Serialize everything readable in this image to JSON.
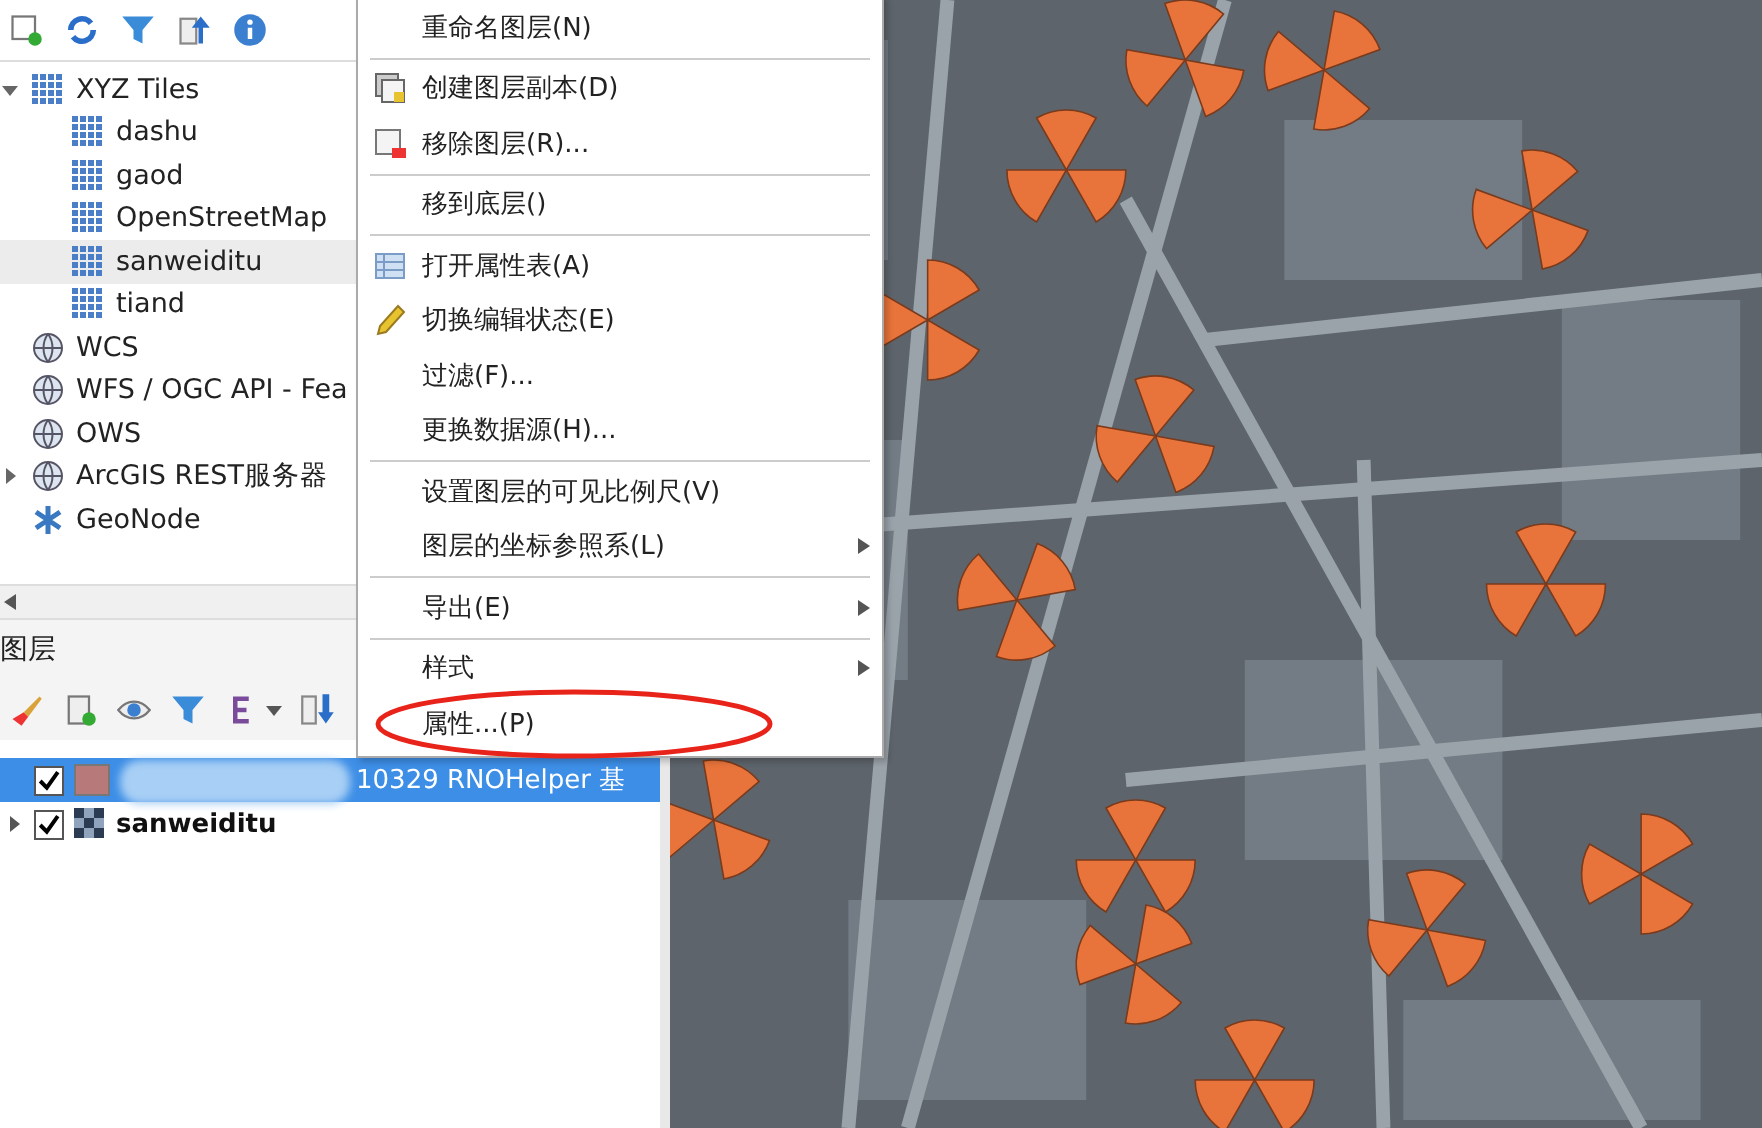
{
  "browser": {
    "tree": [
      {
        "label": "XYZ Tiles",
        "kind": "tiles",
        "expanded": true,
        "selected": false,
        "children": [
          {
            "label": "dashu",
            "kind": "tiles",
            "selected": false
          },
          {
            "label": "gaod",
            "kind": "tiles",
            "selected": false
          },
          {
            "label": "OpenStreetMap",
            "kind": "tiles",
            "selected": false
          },
          {
            "label": "sanweiditu",
            "kind": "tiles",
            "selected": true
          },
          {
            "label": "tiand",
            "kind": "tiles",
            "selected": false
          }
        ]
      },
      {
        "label": "WCS",
        "kind": "service",
        "selected": false
      },
      {
        "label": "WFS / OGC API - Fea",
        "kind": "service",
        "selected": false
      },
      {
        "label": "OWS",
        "kind": "service",
        "selected": false
      },
      {
        "label": "ArcGIS REST服务器",
        "kind": "service",
        "expanded": false,
        "selected": false
      },
      {
        "label": "GeoNode",
        "kind": "geonode",
        "selected": false
      }
    ]
  },
  "layers": {
    "title": "图层",
    "items": [
      {
        "name": "10329 RNOHelper 基",
        "kind": "vector",
        "checked": true,
        "selected": true,
        "redacted": true
      },
      {
        "name": "sanweiditu",
        "kind": "raster",
        "checked": true,
        "selected": false,
        "expanded": false
      }
    ]
  },
  "context_menu": {
    "items": [
      {
        "kind": "item",
        "label": "重命名图层(N)",
        "submenu": false,
        "circled": false
      },
      {
        "kind": "separator"
      },
      {
        "kind": "item",
        "label": "创建图层副本(D)",
        "submenu": false,
        "circled": false
      },
      {
        "kind": "item",
        "label": "移除图层(R)...",
        "submenu": false,
        "circled": false
      },
      {
        "kind": "separator"
      },
      {
        "kind": "item",
        "label": "移到底层()",
        "submenu": false,
        "circled": false
      },
      {
        "kind": "separator"
      },
      {
        "kind": "item",
        "label": "打开属性表(A)",
        "submenu": false,
        "circled": false
      },
      {
        "kind": "item",
        "label": "切换编辑状态(E)",
        "submenu": false,
        "circled": false
      },
      {
        "kind": "item",
        "label": "过滤(F)...",
        "submenu": false,
        "circled": false
      },
      {
        "kind": "item",
        "label": "更换数据源(H)...",
        "submenu": false,
        "circled": false
      },
      {
        "kind": "separator"
      },
      {
        "kind": "item",
        "label": "设置图层的可见比例尺(V)",
        "submenu": false,
        "circled": false
      },
      {
        "kind": "item",
        "label": "图层的坐标参照系(L)",
        "submenu": true,
        "circled": false
      },
      {
        "kind": "separator"
      },
      {
        "kind": "item",
        "label": "导出(E)",
        "submenu": true,
        "circled": false
      },
      {
        "kind": "separator"
      },
      {
        "kind": "item",
        "label": "样式",
        "submenu": true,
        "circled": false
      },
      {
        "kind": "item",
        "label": "属性...(P)",
        "submenu": false,
        "circled": true
      }
    ]
  }
}
